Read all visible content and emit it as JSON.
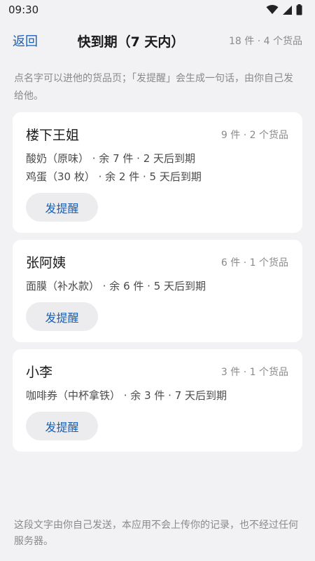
{
  "status": {
    "time": "09:30",
    "icons": [
      "wifi-icon",
      "signal-icon",
      "battery-icon"
    ]
  },
  "header": {
    "back_label": "返回",
    "title": "快到期（7 天内）",
    "summary": "18 件 · 4 个货品"
  },
  "hint": "点名字可以进他的货品页；「发提醒」会生成一句话，由你自己发给他。",
  "cards": [
    {
      "name": "楼下王姐",
      "summary": "9 件 · 2 个货品",
      "items": [
        "酸奶（原味） · 余 7 件 · 2 天后到期",
        "鸡蛋（30 枚） · 余 2 件 · 5 天后到期"
      ],
      "button": "发提醒"
    },
    {
      "name": "张阿姨",
      "summary": "6 件 · 1 个货品",
      "items": [
        "面膜（补水款） · 余 6 件 · 5 天后到期"
      ],
      "button": "发提醒"
    },
    {
      "name": "小李",
      "summary": "3 件 · 1 个货品",
      "items": [
        "咖啡券（中杯拿铁） · 余 3 件 · 7 天后到期"
      ],
      "button": "发提醒"
    }
  ],
  "footer": "这段文字由你自己发送，本应用不会上传你的记录，也不经过任何服务器。",
  "colors": {
    "accent": "#1a5fb4",
    "background": "#f2f2f4",
    "card": "#ffffff",
    "muted_text": "#8a8a8a"
  }
}
